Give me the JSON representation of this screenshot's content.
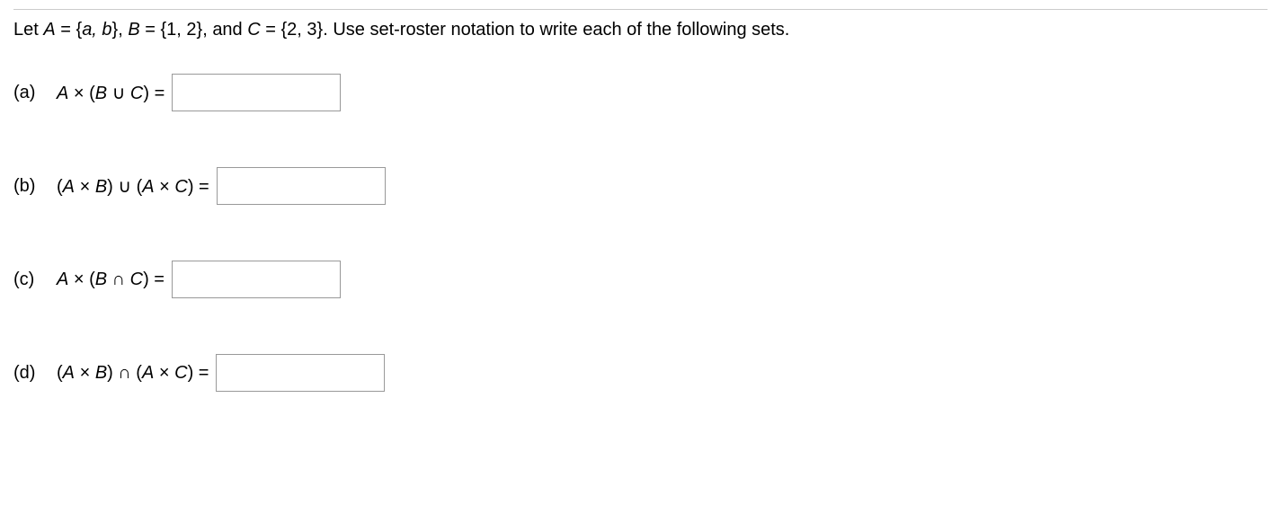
{
  "prompt": {
    "prefix": "Let ",
    "A": "A",
    "A_eq": " = {",
    "A_set_val": "a, b",
    "A_close": "}, ",
    "B": "B",
    "B_eq": " = {1, 2}, and ",
    "C": "C",
    "C_eq": " = {2, 3}. Use set-roster notation to write each of the following sets."
  },
  "questions": {
    "a": {
      "label": "(a)",
      "expr_pre": "A",
      "times": " × (",
      "B": "B",
      "union": " ∪ ",
      "C": "C",
      "close": ") = "
    },
    "b": {
      "label": "(b)",
      "open1": "(",
      "A1": "A",
      "times1": " × ",
      "B1": "B",
      "close1": ") ∪ (",
      "A2": "A",
      "times2": " × ",
      "C2": "C",
      "close2": ") = "
    },
    "c": {
      "label": "(c)",
      "A": "A",
      "times": " × (",
      "B": "B",
      "inter": " ∩ ",
      "C": "C",
      "close": ") = "
    },
    "d": {
      "label": "(d)",
      "open1": "(",
      "A1": "A",
      "times1": " × ",
      "B1": "B",
      "close1": ") ∩ (",
      "A2": "A",
      "times2": " × ",
      "C2": "C",
      "close2": ") = "
    }
  }
}
